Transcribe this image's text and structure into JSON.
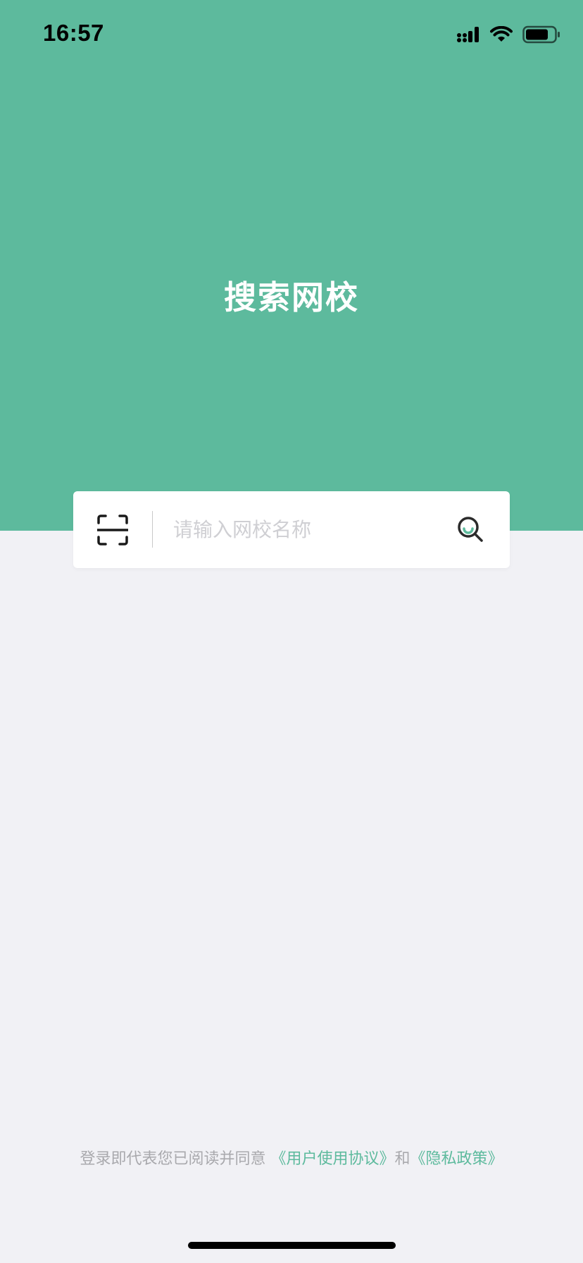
{
  "status_bar": {
    "time": "16:57",
    "icons": [
      "signal-icon",
      "wifi-icon",
      "battery-icon"
    ]
  },
  "hero": {
    "title": "搜索网校",
    "background_color": "#5dba9d"
  },
  "search": {
    "placeholder": "请输入网校名称",
    "value": "",
    "scan_icon": "scan-icon",
    "search_icon": "search-icon"
  },
  "agreement": {
    "prefix": "登录即代表您已阅读并同意",
    "user_agreement": "《用户使用协议》",
    "conjunction": "和",
    "privacy_policy": "《隐私政策》"
  },
  "colors": {
    "accent": "#5dba9d",
    "page_background": "#f1f1f5"
  }
}
